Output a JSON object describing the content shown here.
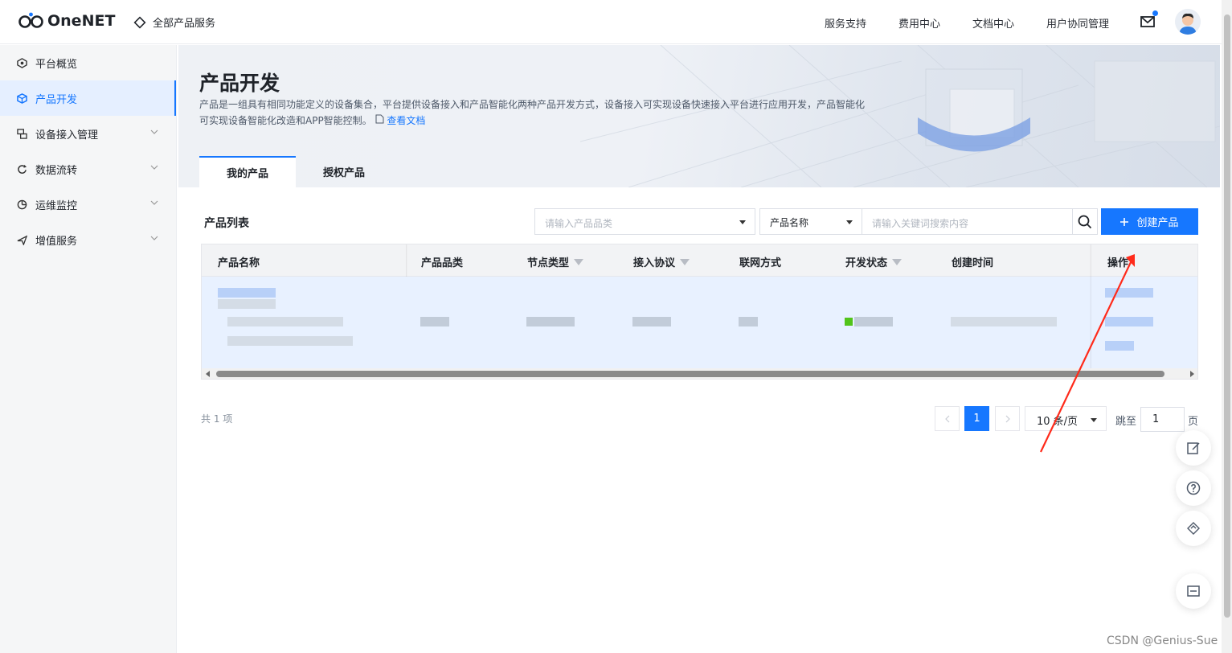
{
  "header": {
    "logo_text": "OneNET",
    "all_services": "全部产品服务",
    "nav": [
      "服务支持",
      "费用中心",
      "文档中心",
      "用户协同管理"
    ]
  },
  "sidebar": {
    "items": [
      {
        "label": "平台概览",
        "icon": "overview-icon",
        "expandable": false
      },
      {
        "label": "产品开发",
        "icon": "product-cube-icon",
        "expandable": false,
        "active": true
      },
      {
        "label": "设备接入管理",
        "icon": "device-icon",
        "expandable": true
      },
      {
        "label": "数据流转",
        "icon": "dataflow-icon",
        "expandable": true
      },
      {
        "label": "运维监控",
        "icon": "monitor-icon",
        "expandable": true
      },
      {
        "label": "增值服务",
        "icon": "value-service-icon",
        "expandable": true
      }
    ]
  },
  "banner": {
    "title": "产品开发",
    "description": "产品是一组具有相同功能定义的设备集合，平台提供设备接入和产品智能化两种产品开发方式，设备接入可实现设备快速接入平台进行应用开发，产品智能化可实现设备智能化改造和APP智能控制。",
    "doc_link": "查看文档",
    "tabs": [
      "我的产品",
      "授权产品"
    ]
  },
  "list": {
    "title": "产品列表",
    "category_placeholder": "请输入产品品类",
    "search_field": "产品名称",
    "keyword_placeholder": "请输入关键词搜索内容",
    "create_button": "创建产品",
    "columns": [
      "产品名称",
      "产品品类",
      "节点类型",
      "接入协议",
      "联网方式",
      "开发状态",
      "创建时间",
      "操作"
    ]
  },
  "pagination": {
    "total": "共 1 项",
    "current_page": "1",
    "page_size": "10 条/页",
    "jump_label": "跳至",
    "jump_value": "1",
    "page_unit": "页"
  },
  "watermark": "CSDN @Genius-Sue",
  "colors": {
    "accent": "#1677ff",
    "row_highlight": "#e8f1ff",
    "annotation_arrow": "#ff2a1a"
  }
}
